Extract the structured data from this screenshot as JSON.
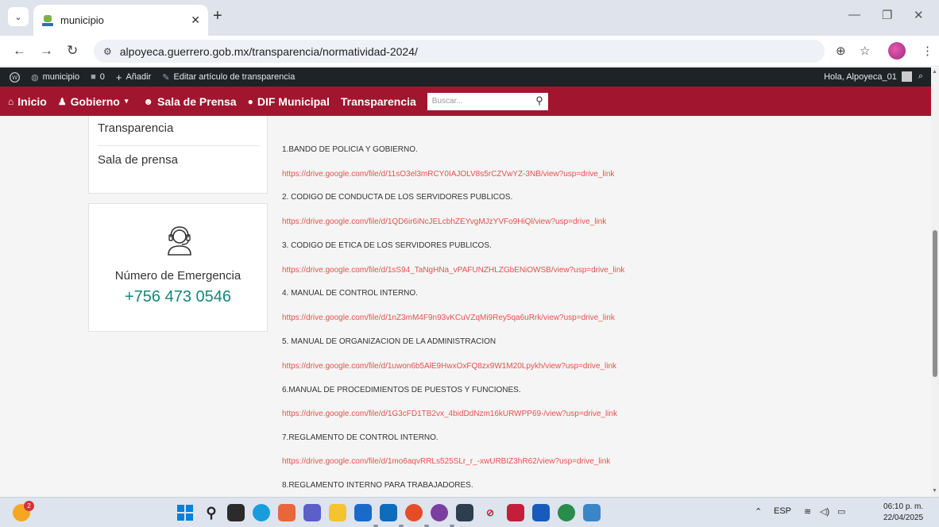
{
  "browser": {
    "tab_title": "municipio",
    "tab_close": "✕",
    "new_tab": "+",
    "url": "alpoyeca.guerrero.gob.mx/transparencia/normatividad-2024/"
  },
  "adminbar": {
    "site_name": "municipio",
    "comments_count": "0",
    "add_label": "Añadir",
    "edit_label": "Editar artículo de transparencia",
    "greeting": "Hola, Alpoyeca_01"
  },
  "sitenav": {
    "items": [
      "Inicio",
      "Gobierno",
      "Sala de Prensa",
      "DIF Municipal",
      "Transparencia"
    ],
    "search_placeholder": "Buscar..."
  },
  "sidebar": {
    "links": [
      "Transparencia",
      "Sala de prensa"
    ],
    "emergency_label": "Número de Emergencia",
    "emergency_phone": "+756 473 0546"
  },
  "documents": [
    {
      "title": "1.BANDO DE POLICIA Y GOBIERNO.",
      "link": "https://drive.google.com/file/d/11sO3el3mRCY0IAJOLV8s5rCZVwYZ-3NB/view?usp=drive_link"
    },
    {
      "title": "2. CODIGO DE CONDUCTA DE LOS SERVIDORES PUBLICOS.",
      "link": "https://drive.google.com/file/d/1QD6ir6iNcJELcbhZEYvgMJzYVFo9HiQl/view?usp=drive_link"
    },
    {
      "title": "3. CODIGO DE ETICA DE LOS SERVIDORES PUBLICOS.",
      "link": "https://drive.google.com/file/d/1sS94_TaNgHNa_vPAFUNZHLZGbENiOWSB/view?usp=drive_link"
    },
    {
      "title": "4. MANUAL DE CONTROL INTERNO.",
      "link": "https://drive.google.com/file/d/1nZ3mM4F9n93vKCuVZqMi9Rey5qa6uRrk/view?usp=drive_link"
    },
    {
      "title": "5. MANUAL DE ORGANIZACION DE LA ADMINISTRACION",
      "link": "https://drive.google.com/file/d/1uwon6b5AlE9HwxOxFQ8zx9W1M20Lpykh/view?usp=drive_link"
    },
    {
      "title": "6.MANUAL DE PROCEDIMIENTOS DE PUESTOS Y FUNCIONES.",
      "link": "https://drive.google.com/file/d/1G3cFD1TB2vx_4bidDdNzm16kURWPP69-/view?usp=drive_link"
    },
    {
      "title": "7.REGLAMENTO DE CONTROL INTERNO.",
      "link": "https://drive.google.com/file/d/1mo6aqvRRLs525SLr_r_-xwURBIZ3hR62/view?usp=drive_link"
    },
    {
      "title": "8.REGLAMENTO INTERNO PARA TRABAJADORES.",
      "link": ""
    }
  ],
  "taskbar": {
    "notification_count": "2",
    "language": "ESP",
    "time": "06:10 p. m.",
    "date": "22/04/2025"
  },
  "colors": {
    "nav_bg": "#a2152e",
    "link": "#e8504e",
    "phone": "#17857b"
  }
}
